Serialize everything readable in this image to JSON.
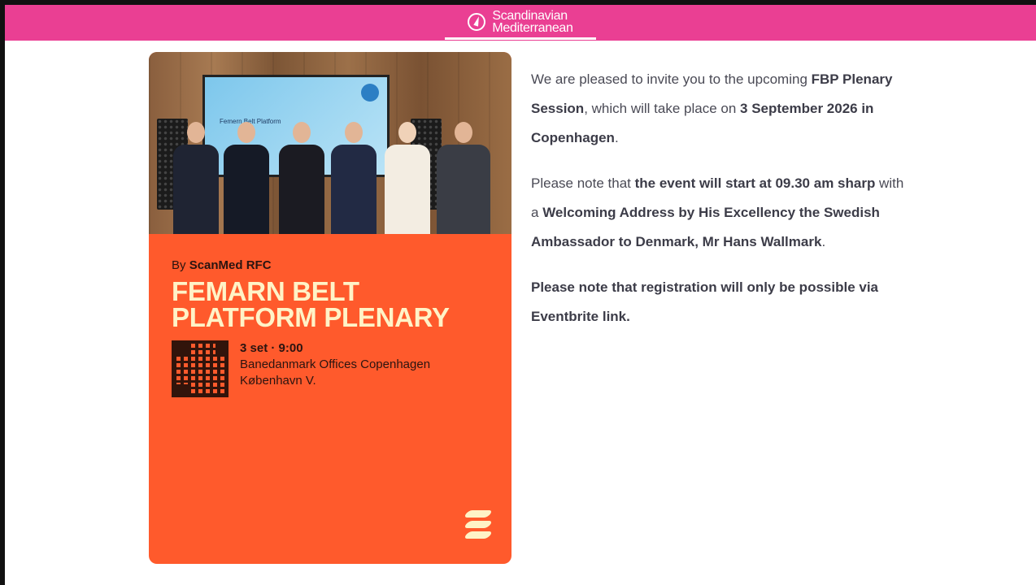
{
  "header": {
    "brand_line1": "Scandinavian",
    "brand_line2": "Mediterranean",
    "brand_icon": "compass-icon",
    "bar_color": "#ea3f93"
  },
  "poster": {
    "by_prefix": "By ",
    "by_org": "ScanMed RFC",
    "headline_line1": "FEMARN BELT",
    "headline_line2": "PLATFORM PLENARY",
    "when": "3 set · 9:00",
    "venue_line1": "Banedanmark Offices Copenhagen",
    "venue_line2": "København V.",
    "screen_title": "Femern Belt Platform",
    "background_color": "#ff5a2c",
    "headline_color": "#fff3c7"
  },
  "copy": {
    "p1_a": "We are pleased to invite you to the upcoming ",
    "p1_b": "FBP Plenary Session",
    "p1_c": ", which will take place on ",
    "p1_d": "3 September 2026 in Copenhagen",
    "p1_e": ".",
    "p2_a": "Please note that ",
    "p2_b": "the event will start at 09.30 am sharp",
    "p2_c": " with a ",
    "p2_d": "Welcoming Address by His Excellency the Swedish Ambassador to Denmark, Mr Hans Wallmark",
    "p2_e": ".",
    "p3": "Please note that registration will only be possible via Eventbrite link."
  }
}
